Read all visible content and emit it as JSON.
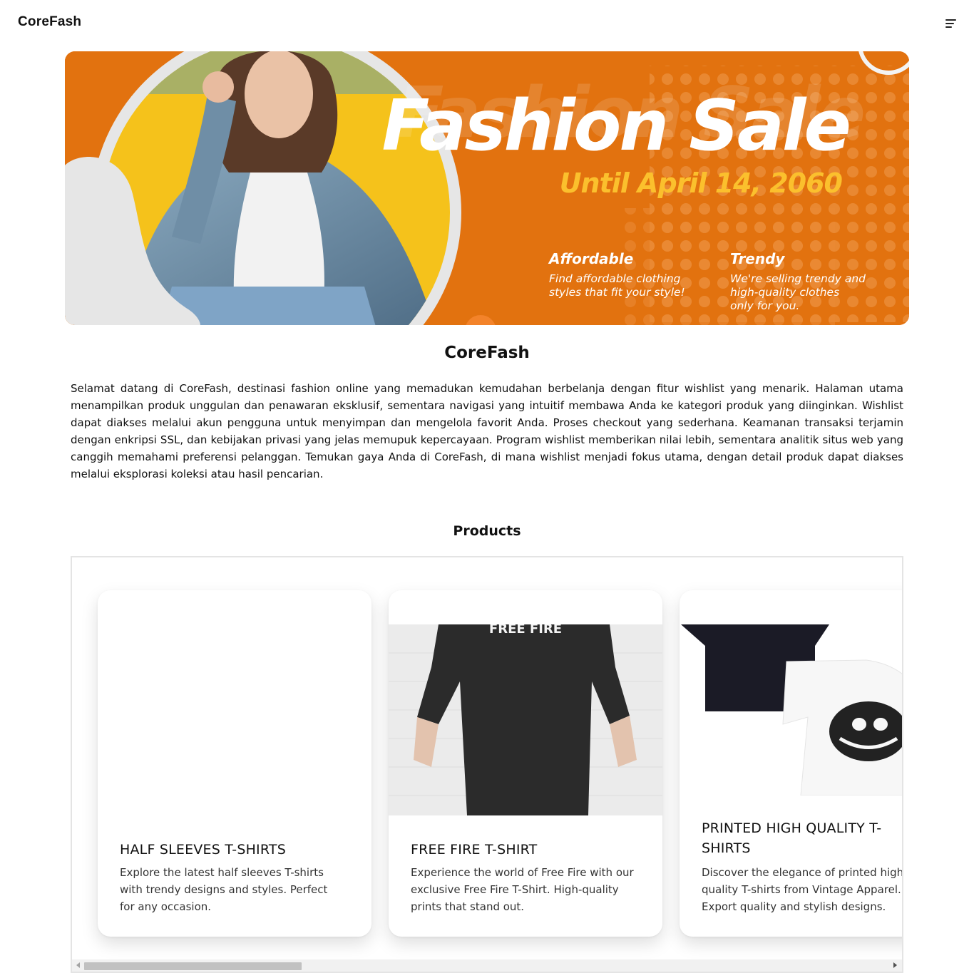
{
  "navbar": {
    "brand": "CoreFash",
    "menu_icon": "hamburger-menu-icon"
  },
  "banner": {
    "headline": "Fashion Sale",
    "date": "Until April 14, 2060",
    "features": [
      {
        "title": "Affordable",
        "lines": [
          "Find affordable clothing",
          "styles that fit your style!"
        ]
      },
      {
        "title": "Trendy",
        "lines": [
          "We're selling trendy and",
          "high-quality clothes",
          "only for you."
        ]
      }
    ],
    "colors": {
      "background": "#e2720f",
      "accent": "#fbc02d",
      "circle": "#f5c21b"
    }
  },
  "intro": {
    "title": "CoreFash",
    "text": "Selamat datang di CoreFash, destinasi fashion online yang memadukan kemudahan berbelanja dengan fitur wishlist yang menarik. Halaman utama menampilkan produk unggulan dan penawaran eksklusif, sementara navigasi yang intuitif membawa Anda ke kategori produk yang diinginkan. Wishlist dapat diakses melalui akun pengguna untuk menyimpan dan mengelola favorit Anda. Proses checkout yang sederhana. Keamanan transaksi terjamin dengan enkripsi SSL, dan kebijakan privasi yang jelas memupuk kepercayaan. Program wishlist memberikan nilai lebih, sementara analitik situs web yang canggih memahami preferensi pelanggan. Temukan gaya Anda di CoreFash, di mana wishlist menjadi fokus utama, dengan detail produk dapat diakses melalui eksplorasi koleksi atau hasil pencarian."
  },
  "products": {
    "title": "Products",
    "items": [
      {
        "name": "HALF SLEEVES T-SHIRTS",
        "name_lines": [
          "HALF SLEEVES T-SHIRTS"
        ],
        "desc_lines": [
          "Explore the latest half sleeves T-shirts",
          "with trendy designs and styles. Perfect",
          "for any occasion."
        ]
      },
      {
        "name": "FREE FIRE T-SHIRT",
        "name_lines": [
          "FREE FIRE T-SHIRT"
        ],
        "desc_lines": [
          "Experience the world of Free Fire with our",
          "exclusive Free Fire T-Shirt. High-quality",
          "prints that stand out."
        ],
        "print_text": "FREE FIRE"
      },
      {
        "name": "PRINTED HIGH QUALITY T-SHIRTS",
        "name_lines": [
          "PRINTED HIGH QUALITY T-",
          "SHIRTS"
        ],
        "desc_lines": [
          "Discover the elegance of printed high",
          "quality T-shirts from Vintage Apparel.",
          "Export quality and stylish designs."
        ]
      }
    ],
    "scrollbar_fraction": 0.27
  }
}
